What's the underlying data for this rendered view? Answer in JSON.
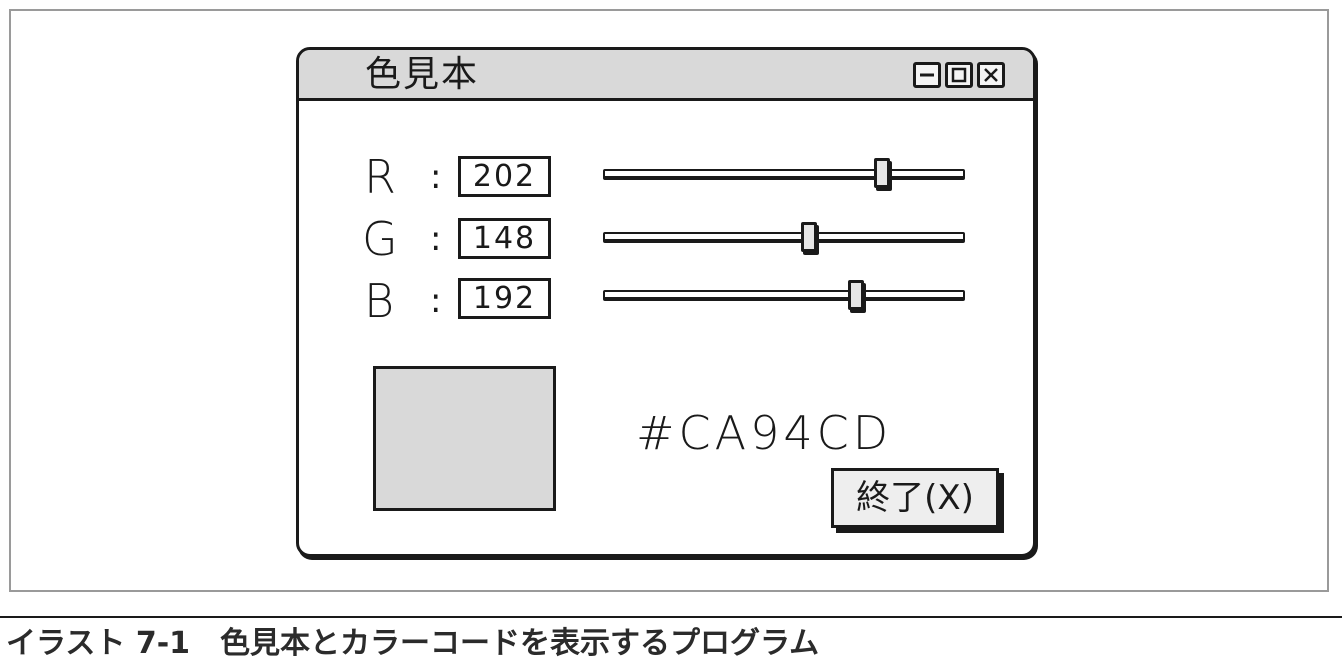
{
  "window": {
    "title": "色見本",
    "controls": [
      {
        "name": "minimize-icon"
      },
      {
        "name": "maximize-icon"
      },
      {
        "name": "close-icon"
      }
    ]
  },
  "rows": [
    {
      "label": "R",
      "colon": ":",
      "value": "202",
      "slider_fraction": 0.77
    },
    {
      "label": "G",
      "colon": ":",
      "value": "148",
      "slider_fraction": 0.57
    },
    {
      "label": "B",
      "colon": ":",
      "value": "192",
      "slider_fraction": 0.7
    }
  ],
  "swatch": {
    "fill": "#d9d9d9"
  },
  "hex_code": "#CA94CD",
  "exit_button": {
    "label": "終了(X)"
  },
  "caption": "イラスト 7-1　色見本とカラーコードを表示するプログラム",
  "colors": {
    "titlebar": "#d9d9d9",
    "ink": "#1a1a1a"
  }
}
